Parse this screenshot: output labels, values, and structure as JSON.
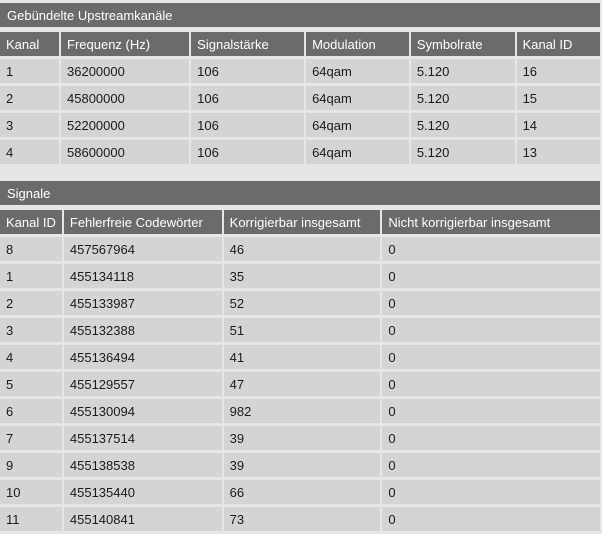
{
  "upstream": {
    "title": "Gebündelte Upstreamkanäle",
    "headers": [
      "Kanal",
      "Frequenz (Hz)",
      "Signalstärke",
      "Modulation",
      "Symbolrate",
      "Kanal ID"
    ],
    "rows": [
      [
        "1",
        "36200000",
        "106",
        "64qam",
        "5.120",
        "16"
      ],
      [
        "2",
        "45800000",
        "106",
        "64qam",
        "5.120",
        "15"
      ],
      [
        "3",
        "52200000",
        "106",
        "64qam",
        "5.120",
        "14"
      ],
      [
        "4",
        "58600000",
        "106",
        "64qam",
        "5.120",
        "13"
      ]
    ]
  },
  "signale": {
    "title": "Signale",
    "headers": [
      "Kanal ID",
      "Fehlerfreie Codewörter",
      "Korrigierbar insgesamt",
      "Nicht korrigierbar insgesamt"
    ],
    "rows": [
      [
        "8",
        "457567964",
        "46",
        "0"
      ],
      [
        "1",
        "455134118",
        "35",
        "0"
      ],
      [
        "2",
        "455133987",
        "52",
        "0"
      ],
      [
        "3",
        "455132388",
        "51",
        "0"
      ],
      [
        "4",
        "455136494",
        "41",
        "0"
      ],
      [
        "5",
        "455129557",
        "47",
        "0"
      ],
      [
        "6",
        "455130094",
        "982",
        "0"
      ],
      [
        "7",
        "455137514",
        "39",
        "0"
      ],
      [
        "9",
        "455138538",
        "39",
        "0"
      ],
      [
        "10",
        "455135440",
        "66",
        "0"
      ],
      [
        "11",
        "455140841",
        "73",
        "0"
      ]
    ]
  }
}
